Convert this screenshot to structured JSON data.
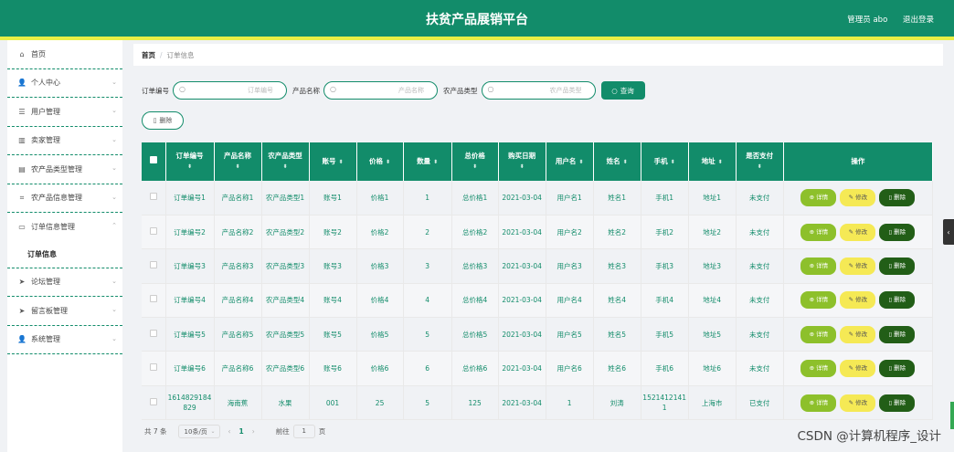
{
  "header": {
    "title": "扶贫产品展销平台",
    "user": "管理员 abo",
    "logout": "退出登录"
  },
  "sidebar": {
    "items": [
      {
        "icon": "home-icon",
        "glyph": "⌂",
        "label": "首页"
      },
      {
        "icon": "user-icon",
        "glyph": "👤",
        "label": "个人中心"
      },
      {
        "icon": "list-icon",
        "glyph": "☰",
        "label": "用户管理"
      },
      {
        "icon": "chart-icon",
        "glyph": "▥",
        "label": "卖家管理"
      },
      {
        "icon": "store-icon",
        "glyph": "▤",
        "label": "农产品类型管理"
      },
      {
        "icon": "crop-icon",
        "glyph": "⌗",
        "label": "农产品信息管理"
      },
      {
        "icon": "chat-icon",
        "glyph": "▭",
        "label": "订单信息管理"
      },
      {
        "icon": "send-icon",
        "glyph": "➤",
        "label": "论坛管理"
      },
      {
        "icon": "send-icon",
        "glyph": "➤",
        "label": "留言板管理"
      },
      {
        "icon": "user-icon",
        "glyph": "👤",
        "label": "系统管理"
      }
    ],
    "sub_item": "订单信息"
  },
  "breadcrumb": {
    "home": "首页",
    "separator": "/",
    "current": "订单信息"
  },
  "search": {
    "order_label": "订单编号",
    "order_placeholder": "订单编号",
    "name_label": "产品名称",
    "name_placeholder": "产品名称",
    "type_label": "农产品类型",
    "type_placeholder": "农产品类型",
    "query_button": "查询",
    "delete_button": "删除"
  },
  "table": {
    "headers": [
      "订单编号",
      "产品名称",
      "农产品类型",
      "账号",
      "价格",
      "数量",
      "总价格",
      "购买日期",
      "用户名",
      "姓名",
      "手机",
      "地址",
      "是否支付",
      "操作"
    ],
    "rows": [
      [
        "订单编号1",
        "产品名称1",
        "农产品类型1",
        "账号1",
        "价格1",
        "1",
        "总价格1",
        "2021-03-04",
        "用户名1",
        "姓名1",
        "手机1",
        "地址1",
        "未支付"
      ],
      [
        "订单编号2",
        "产品名称2",
        "农产品类型2",
        "账号2",
        "价格2",
        "2",
        "总价格2",
        "2021-03-04",
        "用户名2",
        "姓名2",
        "手机2",
        "地址2",
        "未支付"
      ],
      [
        "订单编号3",
        "产品名称3",
        "农产品类型3",
        "账号3",
        "价格3",
        "3",
        "总价格3",
        "2021-03-04",
        "用户名3",
        "姓名3",
        "手机3",
        "地址3",
        "未支付"
      ],
      [
        "订单编号4",
        "产品名称4",
        "农产品类型4",
        "账号4",
        "价格4",
        "4",
        "总价格4",
        "2021-03-04",
        "用户名4",
        "姓名4",
        "手机4",
        "地址4",
        "未支付"
      ],
      [
        "订单编号5",
        "产品名称5",
        "农产品类型5",
        "账号5",
        "价格5",
        "5",
        "总价格5",
        "2021-03-04",
        "用户名5",
        "姓名5",
        "手机5",
        "地址5",
        "未支付"
      ],
      [
        "订单编号6",
        "产品名称6",
        "农产品类型6",
        "账号6",
        "价格6",
        "6",
        "总价格6",
        "2021-03-04",
        "用户名6",
        "姓名6",
        "手机6",
        "地址6",
        "未支付"
      ],
      [
        "1614829184829",
        "海南蕉",
        "水果",
        "001",
        "25",
        "5",
        "125",
        "2021-03-04",
        "1",
        "刘涛",
        "15214121411",
        "上海市",
        "已支付"
      ]
    ],
    "actions": {
      "detail": "详情",
      "edit": "修改",
      "delete": "删除"
    }
  },
  "pagination": {
    "total": "共 7 条",
    "page_size": "10条/页",
    "current_page": "1",
    "goto_label": "前往",
    "goto_value": "1",
    "page_suffix": "页"
  },
  "watermark": "CSDN @计算机程序_设计",
  "colors": {
    "primary": "#128c6a",
    "accent_line": "#e9ef45",
    "detail": "#8dc02b",
    "edit": "#f5e955",
    "delete": "#225e17"
  }
}
